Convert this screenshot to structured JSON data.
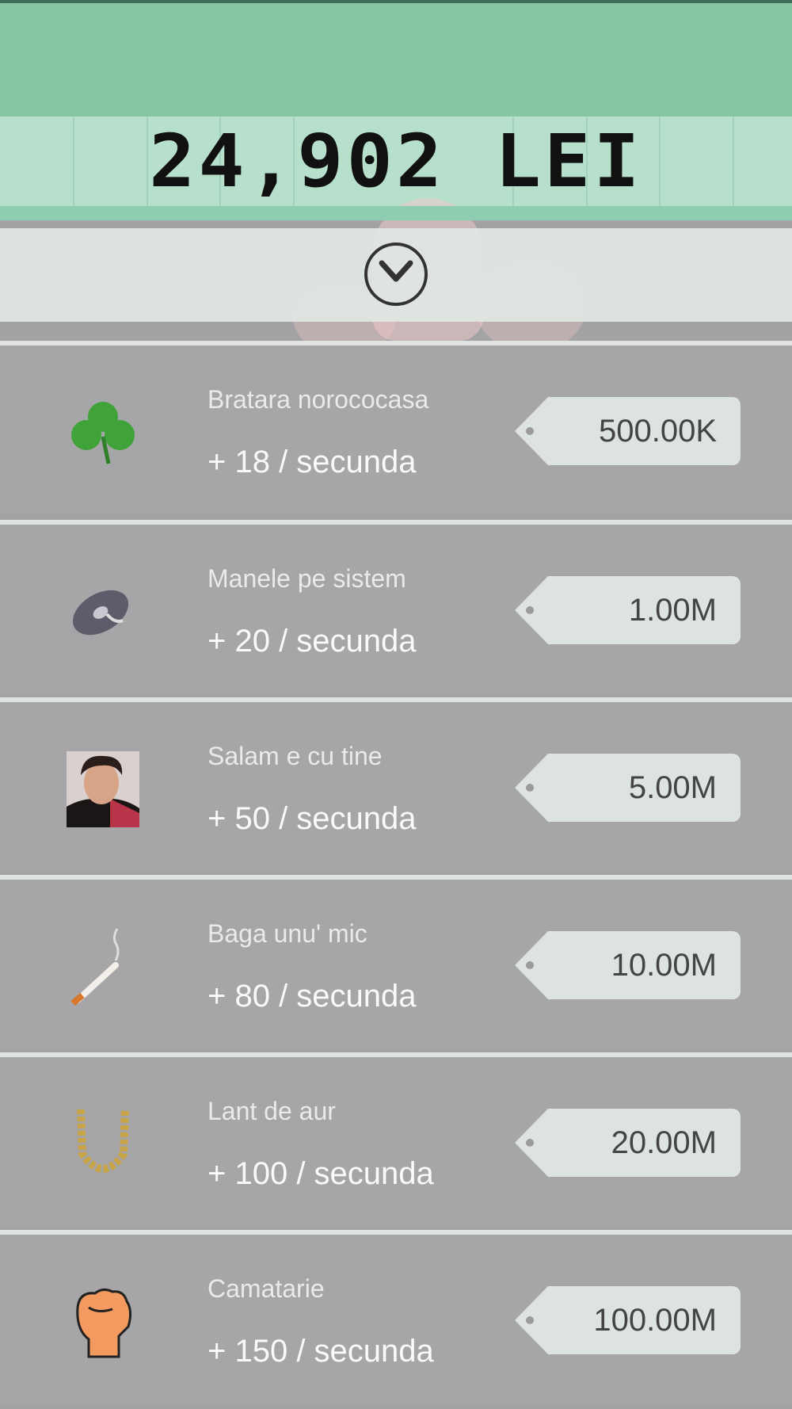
{
  "balance": {
    "text": "24,902 LEI"
  },
  "toggle": {
    "icon": "chevron-down-icon"
  },
  "shop": {
    "items": [
      {
        "name": "Bratara norococasa",
        "rate": "+ 18 / secunda",
        "price": "500.00K",
        "icon": "clover-icon"
      },
      {
        "name": "Manele pe sistem",
        "rate": "+ 20 / secunda",
        "price": "1.00M",
        "icon": "vinyl-record-icon"
      },
      {
        "name": "Salam e cu tine",
        "rate": "+ 50 / secunda",
        "price": "5.00M",
        "icon": "singer-portrait-icon"
      },
      {
        "name": "Baga unu' mic",
        "rate": "+ 80 / secunda",
        "price": "10.00M",
        "icon": "cigarette-icon"
      },
      {
        "name": "Lant de aur",
        "rate": "+ 100 / secunda",
        "price": "20.00M",
        "icon": "gold-chain-icon"
      },
      {
        "name": "Camatarie",
        "rate": "+ 150 / secunda",
        "price": "100.00M",
        "icon": "fist-icon"
      }
    ]
  },
  "colors": {
    "header": "#86c6a5",
    "counter": "#b7e0cc",
    "item_bg": "#a6a5a7",
    "price_tag": "#dde3df"
  }
}
